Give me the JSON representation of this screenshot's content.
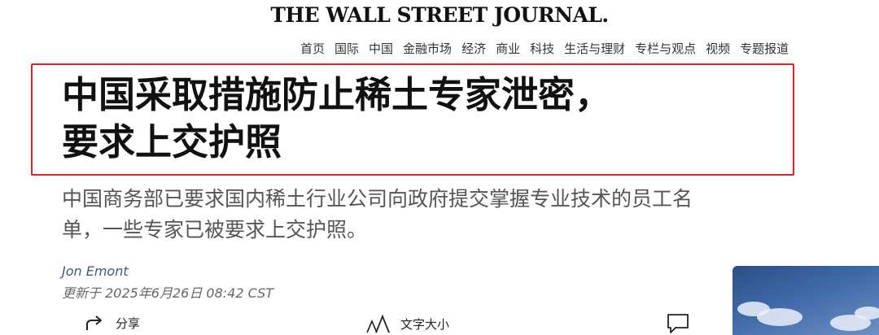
{
  "masthead": {
    "title": "THE WALL STREET JOURNAL."
  },
  "nav": {
    "items": [
      "首页",
      "国际",
      "中国",
      "金融市场",
      "经济",
      "商业",
      "科技",
      "生活与理财",
      "专栏与观点",
      "视频",
      "专题报道"
    ]
  },
  "article": {
    "headline_line1": "中国采取措施防止稀土专家泄密，",
    "headline_line2": "要求上交护照",
    "subhead_line1": "中国商务部已要求国内稀土行业公司向政府提交掌握专业技术的员工名",
    "subhead_line2": "单，一些专家已被要求上交护照。",
    "author": "Jon Emont",
    "timestamp": "更新于 2025年6月26日 08:42 CST",
    "headline_highlight_color": "#d9262b"
  },
  "toolbar": {
    "share_label": "分享",
    "share_icon": "share-arrow-icon",
    "textsize_label": "文字大小",
    "textsize_icon": "text-size-icon",
    "comment_icon": "comment-icon"
  }
}
